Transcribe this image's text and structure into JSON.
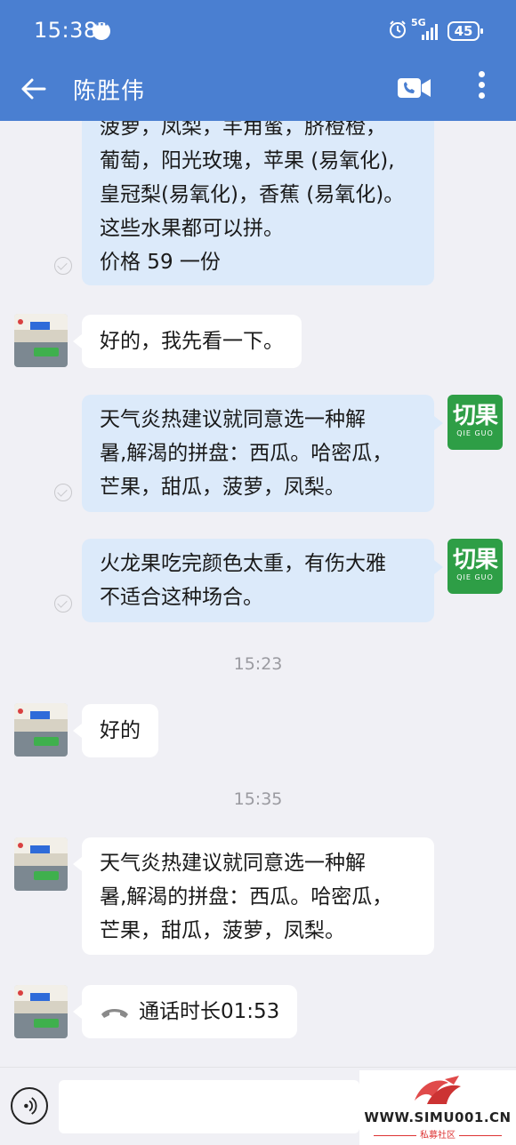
{
  "status_bar": {
    "time": "15:38",
    "network": "5G",
    "battery": "45"
  },
  "header": {
    "title": "陈胜伟"
  },
  "messages": {
    "m1": {
      "lines": [
        "菠萝，凤梨，羊角蜜，脐橙橙，",
        "葡萄，阳光玫瑰，苹果 (易氧化),",
        "皇冠梨(易氧化)，香蕉 (易氧化)。",
        "这些水果都可以拼。",
        "价格 59 一份"
      ]
    },
    "m2": {
      "text": "好的，我先看一下。"
    },
    "m3": {
      "lines": [
        "天气炎热建议就同意选一种解",
        "暑,解渴的拼盘：西瓜。哈密瓜，",
        "芒果，甜瓜，菠萝，凤梨。"
      ]
    },
    "m4": {
      "lines": [
        "火龙果吃完颜色太重，有伤大雅",
        "不适合这种场合。"
      ]
    },
    "time1": "15:23",
    "m5": {
      "text": "好的"
    },
    "time2": "15:35",
    "m6": {
      "lines": [
        "天气炎热建议就同意选一种解",
        "暑,解渴的拼盘：西瓜。哈密瓜，",
        "芒果，甜瓜，菠萝，凤梨。"
      ]
    },
    "m7": {
      "text": "通话时长01:53"
    }
  },
  "brand_logo": {
    "cn": "切果",
    "en": "QIE GUO"
  },
  "watermark": {
    "url": "WWW.SIMU001.CN",
    "sub": "私募社区"
  },
  "colors": {
    "header": "#4a7fd1",
    "out_bubble": "#dceafa",
    "in_bubble": "#ffffff",
    "logo": "#2e9e46"
  }
}
